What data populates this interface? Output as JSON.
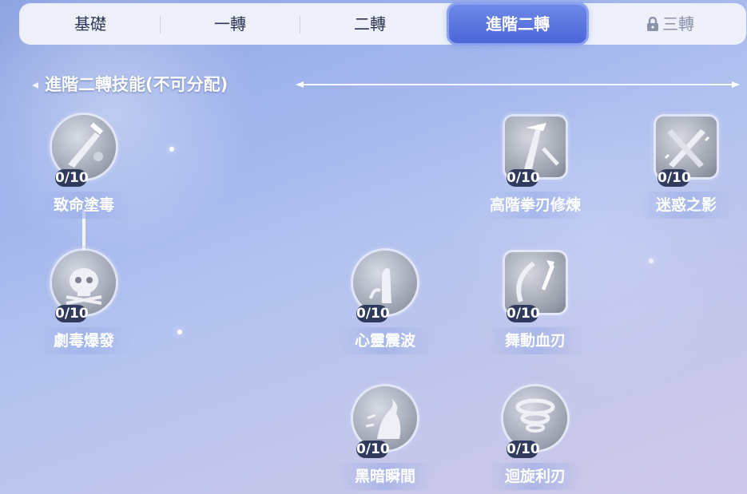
{
  "tabs": [
    {
      "label": "基礎",
      "active": false,
      "locked": false
    },
    {
      "label": "一轉",
      "active": false,
      "locked": false
    },
    {
      "label": "二轉",
      "active": false,
      "locked": false
    },
    {
      "label": "進階二轉",
      "active": true,
      "locked": false
    },
    {
      "label": "三轉",
      "active": false,
      "locked": true
    }
  ],
  "section_title": "進階二轉技能(不可分配)",
  "skills": [
    {
      "name": "致命塗毒",
      "level": "0/10",
      "icon": "poison-sword-icon"
    },
    {
      "name": "劇毒爆發",
      "level": "0/10",
      "icon": "skull-icon"
    },
    {
      "name": "心靈震波",
      "level": "0/10",
      "icon": "palm-wave-icon"
    },
    {
      "name": "黑暗瞬間",
      "level": "0/10",
      "icon": "shadow-figure-icon"
    },
    {
      "name": "高階拳刃修煉",
      "level": "0/10",
      "icon": "claw-blade-icon"
    },
    {
      "name": "舞動血刃",
      "level": "0/10",
      "icon": "spinning-blade-icon"
    },
    {
      "name": "迴旋利刃",
      "level": "0/10",
      "icon": "tornado-icon"
    },
    {
      "name": "迷惑之影",
      "level": "0/10",
      "icon": "crossed-swords-icon"
    }
  ],
  "colors": {
    "accent": "#5a74e0",
    "badge": "#2f3a5c",
    "background": "#a9b9ee"
  }
}
